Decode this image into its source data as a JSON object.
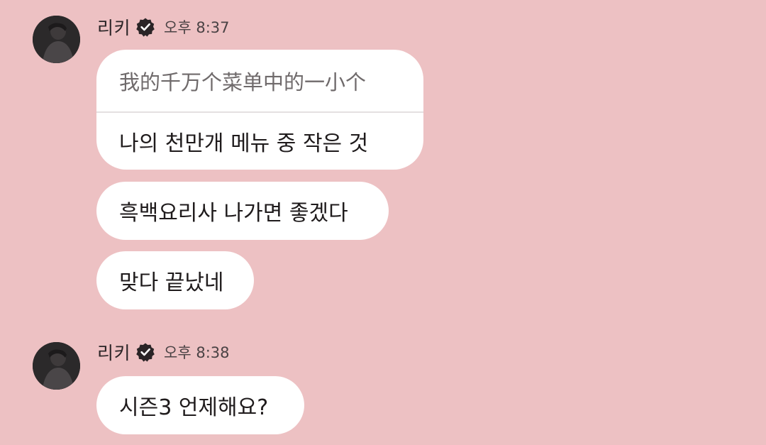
{
  "messages": [
    {
      "sender": "리키",
      "time": "오후 8:37",
      "verified_icon": "verified-badge-icon",
      "bubbles": [
        {
          "original": "我的千万个菜单中的一小个",
          "translated": "나의 천만개 메뉴 중 작은 것"
        },
        {
          "text": "흑백요리사 나가면 좋겠다"
        },
        {
          "text": "맞다 끝났네"
        }
      ]
    },
    {
      "sender": "리키",
      "time": "오후 8:38",
      "verified_icon": "verified-badge-icon",
      "bubbles": [
        {
          "text": "시즌3 언제해요?"
        }
      ]
    }
  ],
  "colors": {
    "background": "#edc1c3",
    "bubble": "#ffffff",
    "text": "#1f1b1c",
    "secondary_text": "#6f6a6b",
    "badge": "#2a2426"
  }
}
